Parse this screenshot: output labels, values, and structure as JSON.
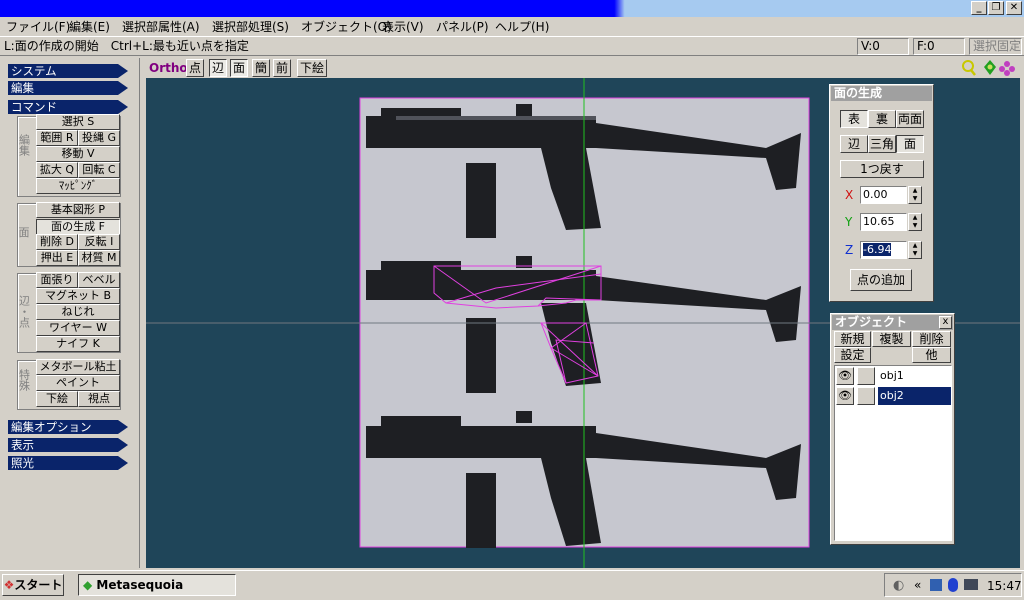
{
  "window": {
    "minimize": "_",
    "restore": "❐",
    "close": "✕"
  },
  "menu": [
    "ファイル(F)",
    "編集(E)",
    "選択部属性(A)",
    "選択部処理(S)",
    "オブジェクト(O)",
    "表示(V)",
    "パネル(P)",
    "ヘルプ(H)"
  ],
  "status": {
    "hint": "L:面の作成の開始　Ctrl+L:最も近い点を指定",
    "v": "V:0",
    "f": "F:0",
    "lock": "選択固定"
  },
  "sidebar": {
    "system": "システム",
    "edit": "編集",
    "command": "コマンド",
    "edit_group": {
      "label": "編集",
      "select": "選択 S",
      "range": "範囲 R",
      "lasso": "投縄 G",
      "move": "移動 V",
      "scale": "拡大 Q",
      "rotate": "回転 C",
      "mapping": "ﾏｯﾋﾟﾝｸﾞ"
    },
    "face_group": {
      "label": "面",
      "basic": "基本図形 P",
      "create": "面の生成 F",
      "delete": "削除 D",
      "flip": "反転 I",
      "extrude": "押出 E",
      "material": "材質 M"
    },
    "edge_group": {
      "label": "辺・点",
      "stretch": "面張り",
      "bevel": "ベベル",
      "magnet": "マグネット B",
      "twist": "ねじれ",
      "wire": "ワイヤー W",
      "knife": "ナイフ K"
    },
    "special_group": {
      "label": "特殊",
      "metaball": "メタボール粘土",
      "paint": "ペイント",
      "underlay": "下絵",
      "viewpoint": "視点"
    },
    "edit_option": "編集オプション",
    "display": "表示",
    "lighting": "照光"
  },
  "viewbar": {
    "mode": "Ortho",
    "vertex": "点",
    "edge": "辺",
    "face": "面",
    "simple": "簡",
    "front": "前",
    "underlay": "下絵"
  },
  "face_panel": {
    "title": "面の生成",
    "front": "表",
    "back": "裏",
    "both": "両面",
    "edge": "辺",
    "triangle": "三角",
    "face": "面",
    "undo": "1つ戻す",
    "x_label": "X",
    "x_val": "0.00",
    "y_label": "Y",
    "y_val": "10.65",
    "z_label": "Z",
    "z_val": "-6.94",
    "add": "点の追加"
  },
  "object_panel": {
    "title": "オブジェクト",
    "close": "x",
    "new": "新規",
    "copy": "複製",
    "delete": "削除",
    "settings": "設定",
    "other": "他",
    "objects": [
      {
        "name": "obj1"
      },
      {
        "name": "obj2"
      }
    ]
  },
  "taskbar": {
    "start": "スタート",
    "app": "Metasequoia",
    "clock": "15:47",
    "chevron": "«"
  },
  "colors": {
    "viewport": "#1f4559",
    "selection": "#0a246a",
    "wire": "#e040e0"
  }
}
